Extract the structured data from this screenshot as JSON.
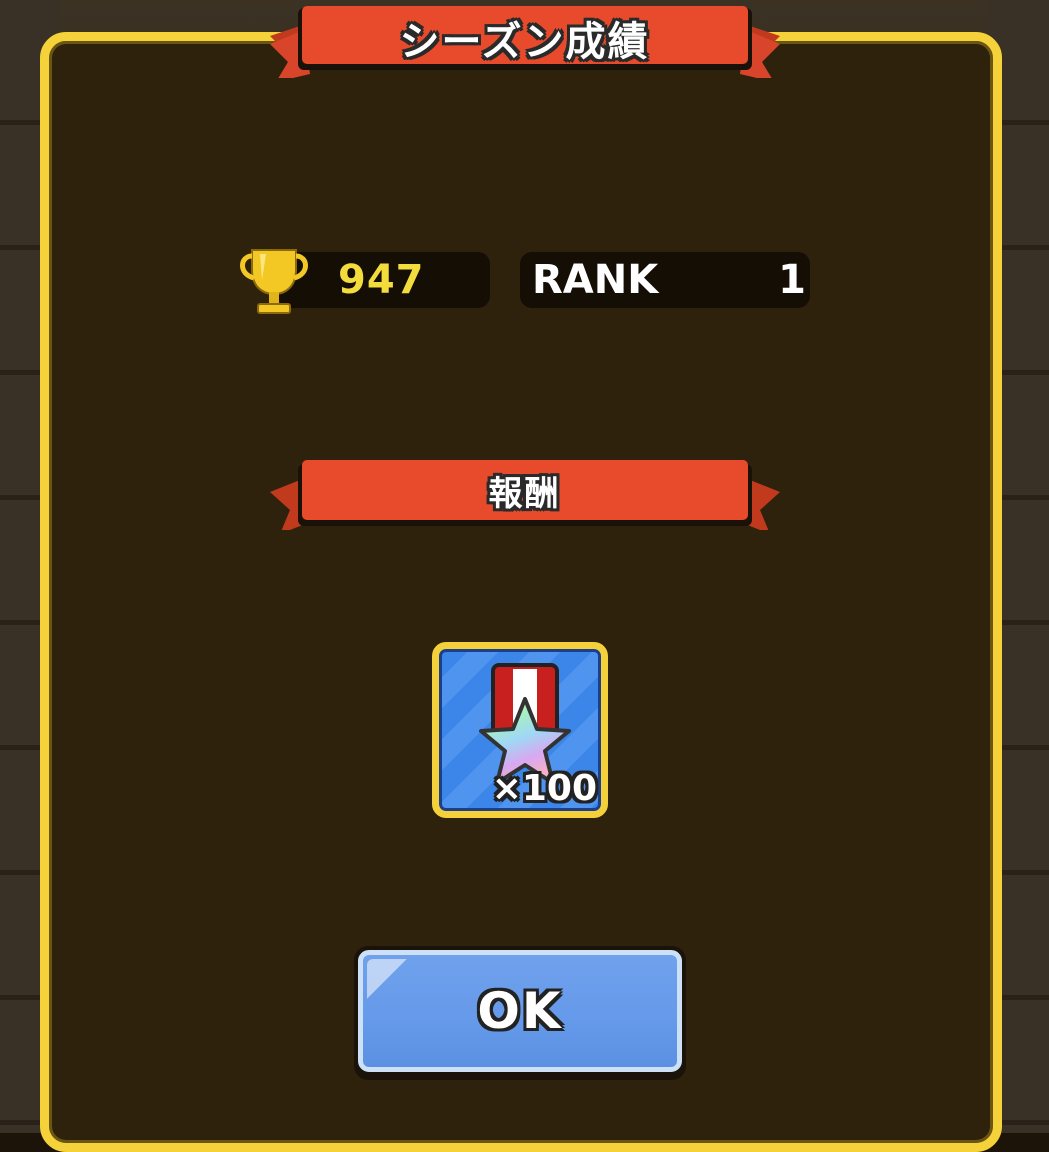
{
  "dialog": {
    "title": "シーズン成績",
    "score": "947",
    "rank_label": "RANK",
    "rank_value": "1",
    "reward_heading": "報酬",
    "reward": {
      "icon": "rainbow-star-medal-icon",
      "quantity": "×100"
    },
    "ok_label": "OK"
  },
  "colors": {
    "panel_border": "#f6d23a",
    "panel_bg": "#2f220c",
    "ribbon": "#e84b2b",
    "score_text": "#f3dd3d",
    "ok_button": "#6599ea"
  }
}
